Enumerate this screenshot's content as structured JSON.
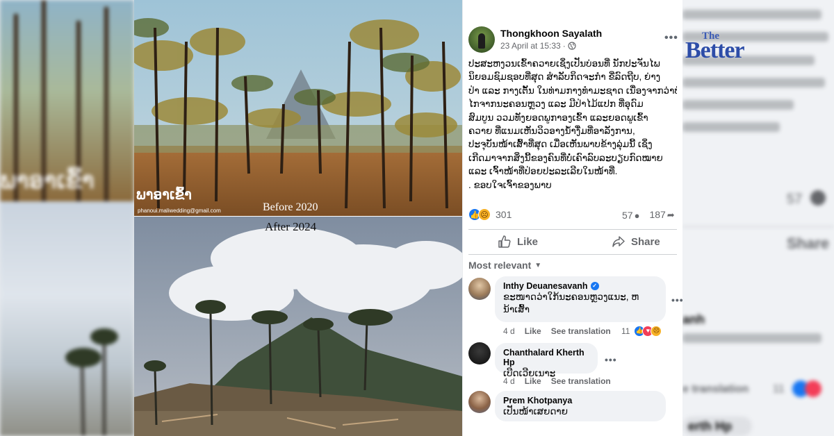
{
  "overlay": {
    "brand_the": "The",
    "brand_word": "Better",
    "photo_watermark_lao": "ພາອາເຂົ້າ",
    "photo_watermark_email": "phanoui.maliwedding@gmail.com",
    "caption_before": "Before 2020",
    "caption_after": "After 2024",
    "bg_left_text": "ພາອາເຂົ້າ"
  },
  "post": {
    "author": "Thongkhoon Sayalath",
    "date": "23 April at 15:33",
    "privacy_icon": "globe-icon",
    "more_label": "•••",
    "body_lines": [
      "ປະສະຫງວນເຂົ້າຄວາຍເຊິ່ງເປັນບ່ອນທີ່ ນັກປະຈັນໄພ",
      "ນິຍອມຊົມຊອບທີ່ສຸດ ສໍາລັບກິດຈະກໍາ ຂີ່ລົດຖີບ, ຍ່າງ",
      "ປ່າ ແລະ ກາງເຕັ້ນ ໃນທ່າມກາງທໍາມະຊາດ ເນື່ອງຈາກວ່າບໍ່",
      "ໄກຈາກນະຄອນຫຼວງ ແລະ ມີປ່າໄມ້ແປກ ທີ່ອຸດົມ",
      "ສົມບູນ ວວມທັງຍອດພູກາອງເຂົ້າ ແລະຍອດພູເຂົ້າ",
      "ຄວາຍ ທີ່ແນມເຫັນວິວອາງນໍ້າງື່ມທີ່ອາລັງການ,",
      "ປະຈຸບັນໜ້າເສົ້າທີ່ສຸດ ເມື່ອເຫັນພາບຂ້າງລຸ່ມນີ້ ເຊິ່ງ",
      "ເກີດມາຈາກສິ່ງນີ້ຂອງຄົນທີ່ບໍ່ເຄົາລົບລະບຽບກົດໝາຍ",
      "ແລະ ເຈົ້າໜ້າທີ່ປ່ອຍປະລະເລີຍໃນໜ້າທີ່.",
      ". ຂອບໃຈເຈົ້າຂອງພາບ"
    ],
    "reaction_count": "301",
    "comment_count": "57",
    "share_count": "187",
    "like_label": "Like",
    "share_label": "Share",
    "sort_label": "Most relevant"
  },
  "comments": [
    {
      "name": "Inthy Deuanesavanh",
      "verified": true,
      "text_lines": [
        "ຂະໜາດວ່າໃກ້ນະຄອນຫຼວງແນະ, ຫ",
        "ນ້າເສົ້າ"
      ],
      "time": "4 d",
      "like_label": "Like",
      "translate_label": "See translation",
      "reaction_count": "11"
    },
    {
      "name": "Chanthalard Kherth Hp",
      "verified": false,
      "text_lines": [
        "ເບີດເວີຍເນາະ"
      ],
      "time": "4 d",
      "like_label": "Like",
      "translate_label": "See translation"
    },
    {
      "name": "Prem Khotpanya",
      "verified": false,
      "text_lines": [
        "ເປັນໜ້າເສຍດາຍ"
      ]
    }
  ],
  "blurred_right": {
    "count": "57",
    "share": "Share",
    "translation": "e translation",
    "count2": "11",
    "name_fragment": "anh",
    "name2_fragment": "erth Hp"
  },
  "colors": {
    "facebook_blue": "#1877f2",
    "text_primary": "#050505",
    "text_secondary": "#65676b",
    "bubble": "#f0f2f5"
  }
}
